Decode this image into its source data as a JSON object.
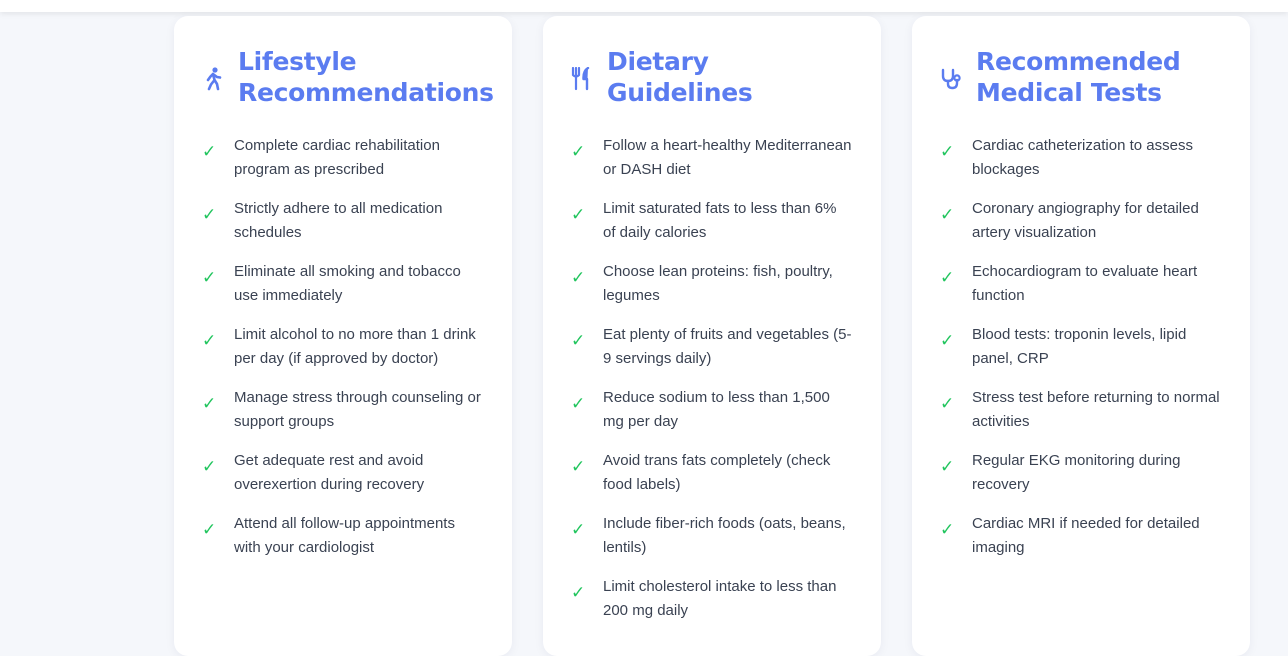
{
  "colors": {
    "accent": "#5b7cf0",
    "check": "#22c55e",
    "text": "#3a4252"
  },
  "cards": [
    {
      "icon": "walking-person-icon",
      "title": "Lifestyle Recommendations",
      "items": [
        "Complete cardiac rehabilitation program as prescribed",
        "Strictly adhere to all medication schedules",
        "Eliminate all smoking and tobacco use immediately",
        "Limit alcohol to no more than 1 drink per day (if approved by doctor)",
        "Manage stress through counseling or support groups",
        "Get adequate rest and avoid overexertion during recovery",
        "Attend all follow-up appointments with your cardiologist"
      ]
    },
    {
      "icon": "utensils-icon",
      "title": "Dietary Guidelines",
      "items": [
        "Follow a heart-healthy Mediterranean or DASH diet",
        "Limit saturated fats to less than 6% of daily calories",
        "Choose lean proteins: fish, poultry, legumes",
        "Eat plenty of fruits and vegetables (5-9 servings daily)",
        "Reduce sodium to less than 1,500 mg per day",
        "Avoid trans fats completely (check food labels)",
        "Include fiber-rich foods (oats, beans, lentils)",
        "Limit cholesterol intake to less than 200 mg daily"
      ]
    },
    {
      "icon": "stethoscope-icon",
      "title": "Recommended Medical Tests",
      "items": [
        "Cardiac catheterization to assess blockages",
        "Coronary angiography for detailed artery visualization",
        "Echocardiogram to evaluate heart function",
        "Blood tests: troponin levels, lipid panel, CRP",
        "Stress test before returning to normal activities",
        "Regular EKG monitoring during recovery",
        "Cardiac MRI if needed for detailed imaging"
      ]
    }
  ],
  "check_glyph": "✓"
}
